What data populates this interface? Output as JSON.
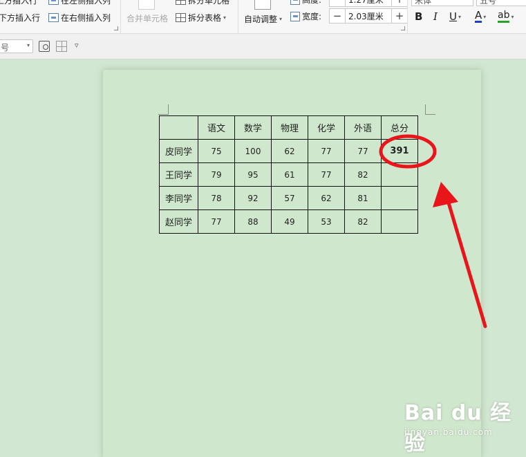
{
  "ribbon": {
    "insert_above_row": "上方插入行",
    "insert_left_col": "在左侧插入列",
    "insert_below_row": "下方插入行",
    "insert_right_col": "在右侧插入列",
    "merge_cells": "合并单元格",
    "split_cells": "拆分单元格",
    "split_table": "拆分表格",
    "auto_adjust": "自动调整",
    "height_label": "高度:",
    "height_value": "1.27厘米",
    "width_label": "宽度:",
    "width_value": "2.03厘米",
    "minus": "−",
    "plus": "+",
    "font_name": "宋体",
    "font_size": "五号",
    "bold": "B",
    "italic": "I",
    "underline": "U",
    "font_color": "A",
    "highlight": "ab",
    "dropdown": "▾"
  },
  "toolbar2": {
    "style_value": "号",
    "dropdown": "▾",
    "more": "▿"
  },
  "table": {
    "headers": [
      "",
      "语文",
      "数学",
      "物理",
      "化学",
      "外语",
      "总分"
    ],
    "rows": [
      [
        "皮同学",
        "75",
        "100",
        "62",
        "77",
        "77",
        "391"
      ],
      [
        "王同学",
        "79",
        "95",
        "61",
        "77",
        "82",
        ""
      ],
      [
        "李同学",
        "78",
        "92",
        "57",
        "62",
        "81",
        ""
      ],
      [
        "赵同学",
        "77",
        "88",
        "49",
        "53",
        "82",
        ""
      ]
    ]
  },
  "annotation": {
    "color": "#e8161a"
  },
  "watermark": {
    "brand": "Bai du 经验",
    "url": "jingyan.baidu.com"
  }
}
